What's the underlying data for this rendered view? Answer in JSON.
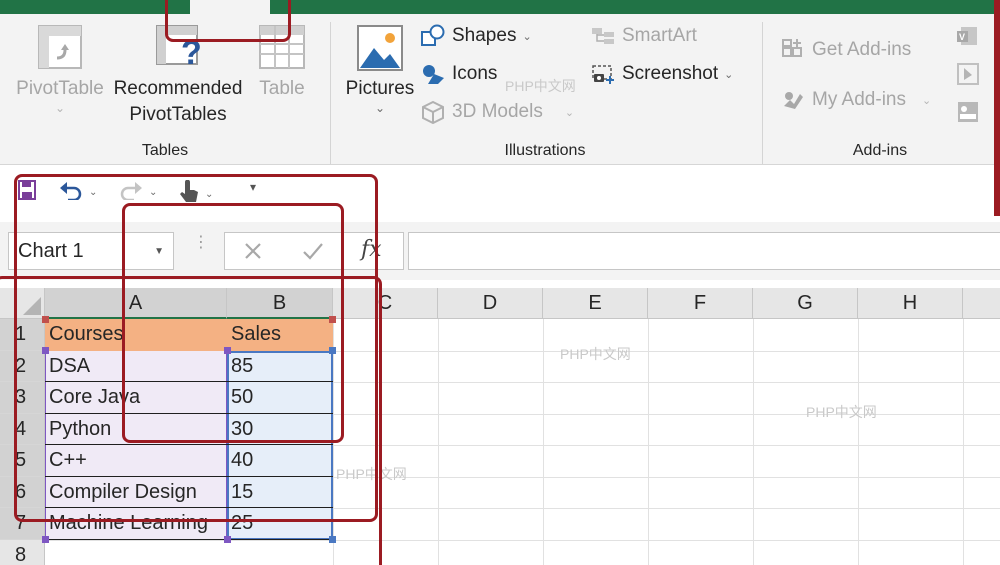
{
  "ribbon": {
    "tables": {
      "label": "Tables",
      "pivot_line1": "PivotTable",
      "recommended_line1": "Recommended",
      "recommended_line2": "PivotTables",
      "table": "Table"
    },
    "illustrations": {
      "label": "Illustrations",
      "pictures": "Pictures",
      "shapes": "Shapes",
      "icons": "Icons",
      "models3d": "3D Models",
      "smartart": "SmartArt",
      "screenshot": "Screenshot"
    },
    "addins": {
      "label": "Add-ins",
      "get": "Get Add-ins",
      "my": "My Add-ins"
    }
  },
  "namebox": {
    "value": "Chart 1"
  },
  "formula": {
    "fx": "fx"
  },
  "columns": [
    "A",
    "B",
    "C",
    "D",
    "E",
    "F",
    "G",
    "H"
  ],
  "rows": [
    "1",
    "2",
    "3",
    "4",
    "5",
    "6",
    "7",
    "8"
  ],
  "table": {
    "headers": [
      "Courses",
      "Sales"
    ],
    "rows": [
      [
        "DSA",
        "85"
      ],
      [
        "Core Java",
        "50"
      ],
      [
        "Python",
        "30"
      ],
      [
        "C++",
        "40"
      ],
      [
        "Compiler Design",
        "15"
      ],
      [
        "Machine Learning",
        "25"
      ]
    ]
  },
  "watermark": "PHP中文网",
  "colors": {
    "accent": "#217346",
    "header_fill": "#f4b183",
    "range_a": "#7e57c2",
    "range_b": "#4a78c2",
    "annotation": "#9b1b22"
  }
}
